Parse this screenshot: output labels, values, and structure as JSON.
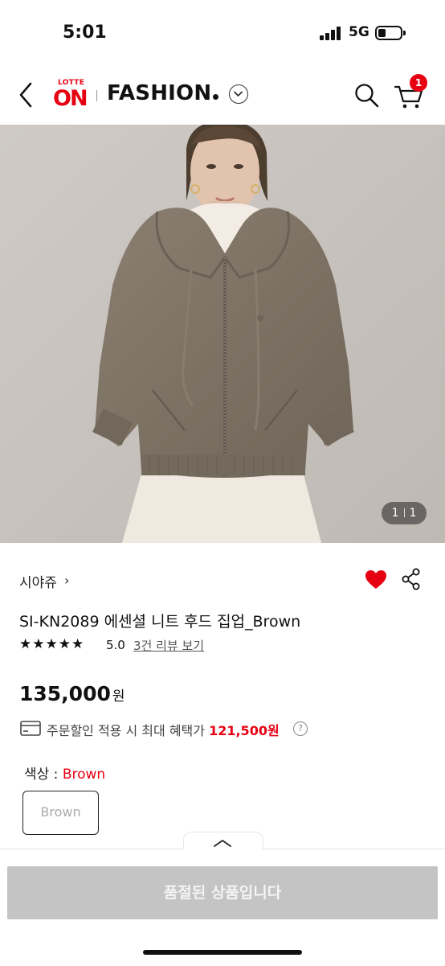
{
  "status_bar": {
    "time": "5:01",
    "network": "5G"
  },
  "header": {
    "logo_small": "LOTTE",
    "logo_main": "ON",
    "title": "FASHION",
    "cart_count": "1",
    "icons": [
      "back-icon",
      "chevron-down-icon",
      "search-icon",
      "cart-icon"
    ]
  },
  "gallery": {
    "current": "1",
    "total": "1"
  },
  "product": {
    "brand": "시야쥬",
    "brand_arrow": "›",
    "title": "SI-KN2089 에센셜 니트 후드 집업_Brown",
    "stars": "★★★★★",
    "rating": "5.0",
    "review_link": "3건 리뷰 보기",
    "price": "135,000",
    "price_unit": "원",
    "benefit_text": "주문할인 적용 시 최대 혜택가",
    "benefit_price": "121,500원",
    "help_label": "?",
    "wishlist_active": true
  },
  "option": {
    "label": "색상 : ",
    "selected": "Brown",
    "options": [
      "Brown"
    ]
  },
  "bottom_bar": {
    "button_label": "품절된 상품입니다"
  },
  "colors": {
    "accent": "#e60012",
    "disabled_button": "#c4c4c4",
    "sweater": "#7e7364",
    "background": "#c8c4c0"
  }
}
